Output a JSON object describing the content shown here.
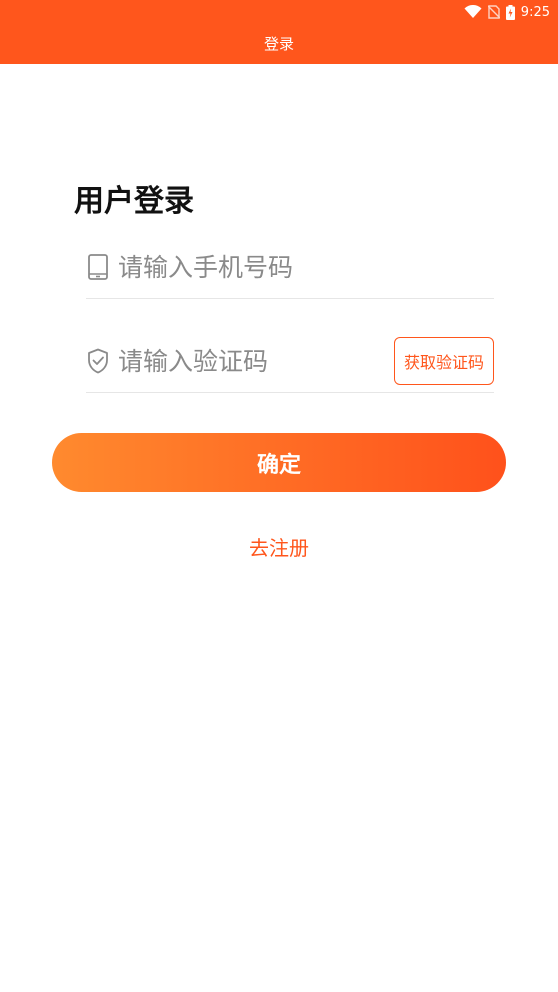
{
  "status_bar": {
    "time": "9:25",
    "icons": [
      "wifi-icon",
      "no-sim-icon",
      "battery-charging-icon"
    ]
  },
  "app_bar": {
    "title": "登录"
  },
  "login": {
    "title": "用户登录",
    "phone_field": {
      "icon": "phone-icon",
      "placeholder": "请输入手机号码",
      "value": ""
    },
    "code_field": {
      "icon": "shield-check-icon",
      "placeholder": "请输入验证码",
      "value": ""
    },
    "get_code_label": "获取验证码",
    "confirm_label": "确定",
    "register_label": "去注册"
  },
  "colors": {
    "accent": "#FF561C",
    "gradient_start": "#FF8A2E",
    "gradient_end": "#FF511B"
  }
}
